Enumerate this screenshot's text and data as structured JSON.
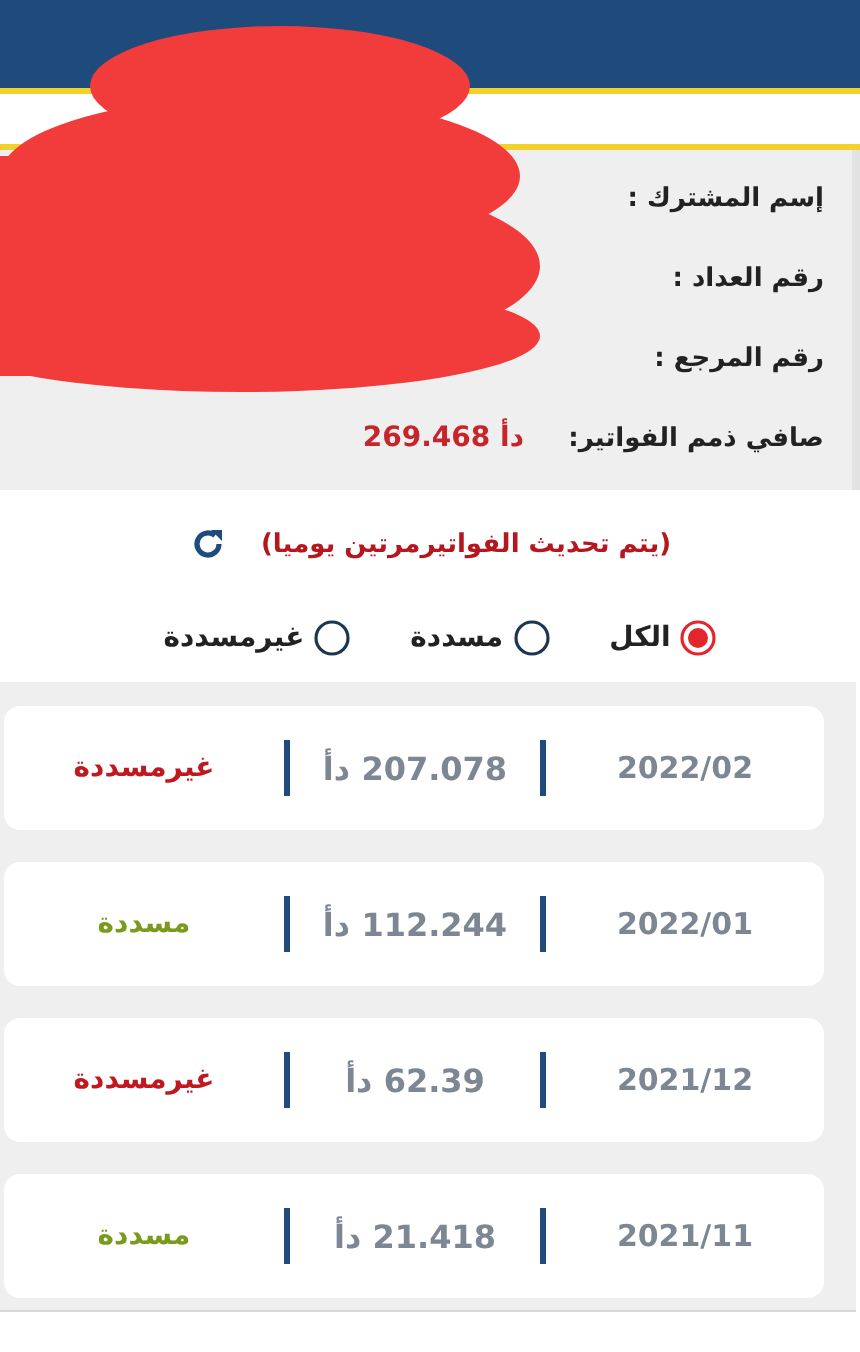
{
  "info": {
    "fields": [
      {
        "label": "إسم المشترك :"
      },
      {
        "label": "رقم العداد :"
      },
      {
        "label": "رقم المرجع :"
      },
      {
        "label": "صافي ذمم الفواتير:",
        "value": "دأ 269.468"
      }
    ]
  },
  "update_note": "(يتم تحديث الفواتيرمرتين يوميا)",
  "filters": [
    {
      "label": "الكل",
      "selected": true
    },
    {
      "label": "مسددة",
      "selected": false
    },
    {
      "label": "غيرمسددة",
      "selected": false
    }
  ],
  "invoices": [
    {
      "month": "2022/02",
      "amount": "207.078 دأ",
      "status": "غيرمسددة",
      "paid": false
    },
    {
      "month": "2022/01",
      "amount": "112.244 دأ",
      "status": "مسددة",
      "paid": true
    },
    {
      "month": "2021/12",
      "amount": "62.39 دأ",
      "status": "غيرمسددة",
      "paid": false
    },
    {
      "month": "2021/11",
      "amount": "21.418 دأ",
      "status": "مسددة",
      "paid": true
    }
  ]
}
